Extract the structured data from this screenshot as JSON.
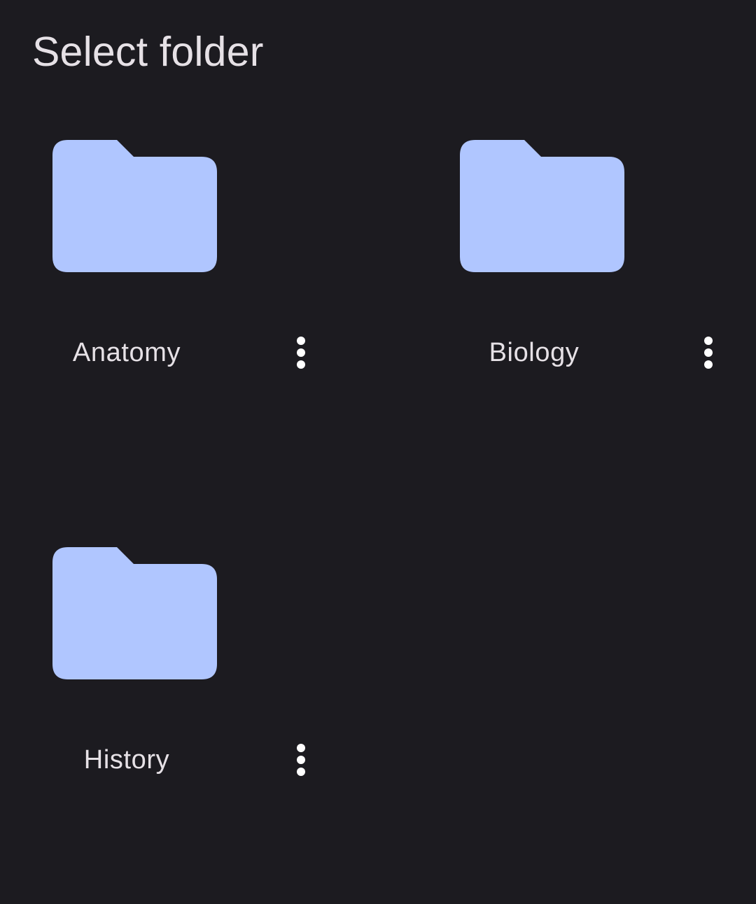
{
  "header": {
    "title": "Select folder"
  },
  "colors": {
    "background": "#1c1b20",
    "folder": "#b0c6ff",
    "text": "#e6e1e6",
    "menu_icon": "#ffffff"
  },
  "folders": [
    {
      "name": "Anatomy",
      "icon": "folder-icon",
      "menu_icon": "more-vert-icon"
    },
    {
      "name": "Biology",
      "icon": "folder-icon",
      "menu_icon": "more-vert-icon"
    },
    {
      "name": "History",
      "icon": "folder-icon",
      "menu_icon": "more-vert-icon"
    }
  ]
}
